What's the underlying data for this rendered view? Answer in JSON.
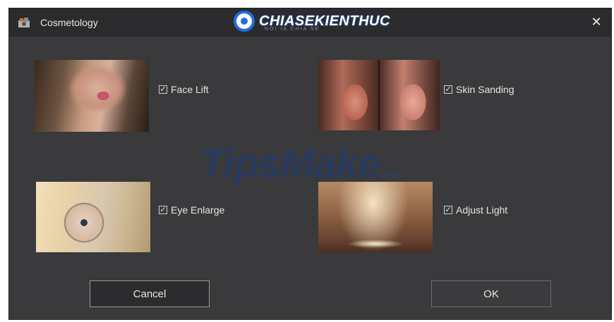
{
  "window": {
    "title": "Cosmetology",
    "close_icon": "close-icon"
  },
  "watermarks": {
    "top_logo": "CHIASEKIENTHUC",
    "top_logo_sub": "NOI IA CHIA SE",
    "center_brand": "TipsMake",
    "center_suffix": ".com"
  },
  "options": [
    {
      "label": "Face Lift",
      "checked": true,
      "thumbnail": "face-lift-thumbnail"
    },
    {
      "label": "Skin Sanding",
      "checked": true,
      "thumbnail": "skin-sanding-thumbnail"
    },
    {
      "label": "Eye Enlarge",
      "checked": true,
      "thumbnail": "eye-enlarge-thumbnail"
    },
    {
      "label": "Adjust Light",
      "checked": true,
      "thumbnail": "adjust-light-thumbnail"
    }
  ],
  "buttons": {
    "cancel": "Cancel",
    "ok": "OK"
  },
  "colors": {
    "window_bg": "#3a393c",
    "titlebar_bg": "#2b2b2d",
    "text": "#e6e6e6",
    "logo_blue": "#1f6fe0"
  }
}
